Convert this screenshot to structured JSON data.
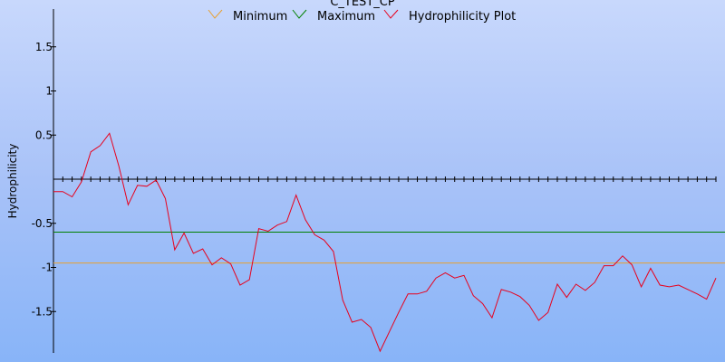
{
  "chart_data": {
    "type": "line",
    "title": "C_TEST_CP",
    "xlabel": "",
    "ylabel": "Hydrophilicity",
    "ylim": [
      -2.0,
      1.95
    ],
    "xlim": [
      0,
      71
    ],
    "yticks": [
      1.5,
      1,
      0.5,
      -0.5,
      -1,
      -1.5
    ],
    "ytick_labels": [
      "1.5",
      "1",
      "0.5",
      "-0.5",
      "-1",
      "-1.5"
    ],
    "zero_axis_ticks": 71,
    "legend_position": "top",
    "series": [
      {
        "name": "Minimum",
        "color": "#e8a030",
        "kind": "hline",
        "value": -0.95
      },
      {
        "name": "Maximum",
        "color": "#008000",
        "kind": "hline",
        "value": -0.6
      },
      {
        "name": "Hydrophilicity Plot",
        "color": "#e8001c",
        "kind": "line",
        "x": [
          0,
          1,
          2,
          3,
          4,
          5,
          6,
          7,
          8,
          9,
          10,
          11,
          12,
          13,
          14,
          15,
          16,
          17,
          18,
          19,
          20,
          21,
          22,
          23,
          24,
          25,
          26,
          27,
          28,
          29,
          30,
          31,
          32,
          33,
          34,
          35,
          36,
          37,
          38,
          39,
          40,
          41,
          42,
          43,
          44,
          45,
          46,
          47,
          48,
          49,
          50,
          51,
          52,
          53,
          54,
          55,
          56,
          57,
          58,
          59,
          60,
          61,
          62,
          63,
          64,
          65,
          66,
          67,
          68,
          69,
          70,
          71
        ],
        "values": [
          -0.14,
          -0.14,
          -0.2,
          -0.03,
          0.31,
          0.38,
          0.52,
          0.15,
          -0.29,
          -0.07,
          -0.08,
          -0.01,
          -0.22,
          -0.8,
          -0.61,
          -0.84,
          -0.79,
          -0.97,
          -0.89,
          -0.96,
          -1.2,
          -1.14,
          -0.56,
          -0.59,
          -0.52,
          -0.48,
          -0.18,
          -0.46,
          -0.63,
          -0.69,
          -0.82,
          -1.37,
          -1.62,
          -1.59,
          -1.68,
          -1.95,
          -1.73,
          -1.51,
          -1.3,
          -1.3,
          -1.27,
          -1.12,
          -1.06,
          -1.12,
          -1.09,
          -1.32,
          -1.41,
          -1.57,
          -1.25,
          -1.28,
          -1.33,
          -1.43,
          -1.6,
          -1.51,
          -1.19,
          -1.34,
          -1.19,
          -1.26,
          -1.17,
          -0.98,
          -0.98,
          -0.87,
          -0.97,
          -1.22,
          -1.01,
          -1.2,
          -1.22,
          -1.2,
          -1.25,
          -1.3,
          -1.36,
          -1.12
        ]
      }
    ]
  }
}
